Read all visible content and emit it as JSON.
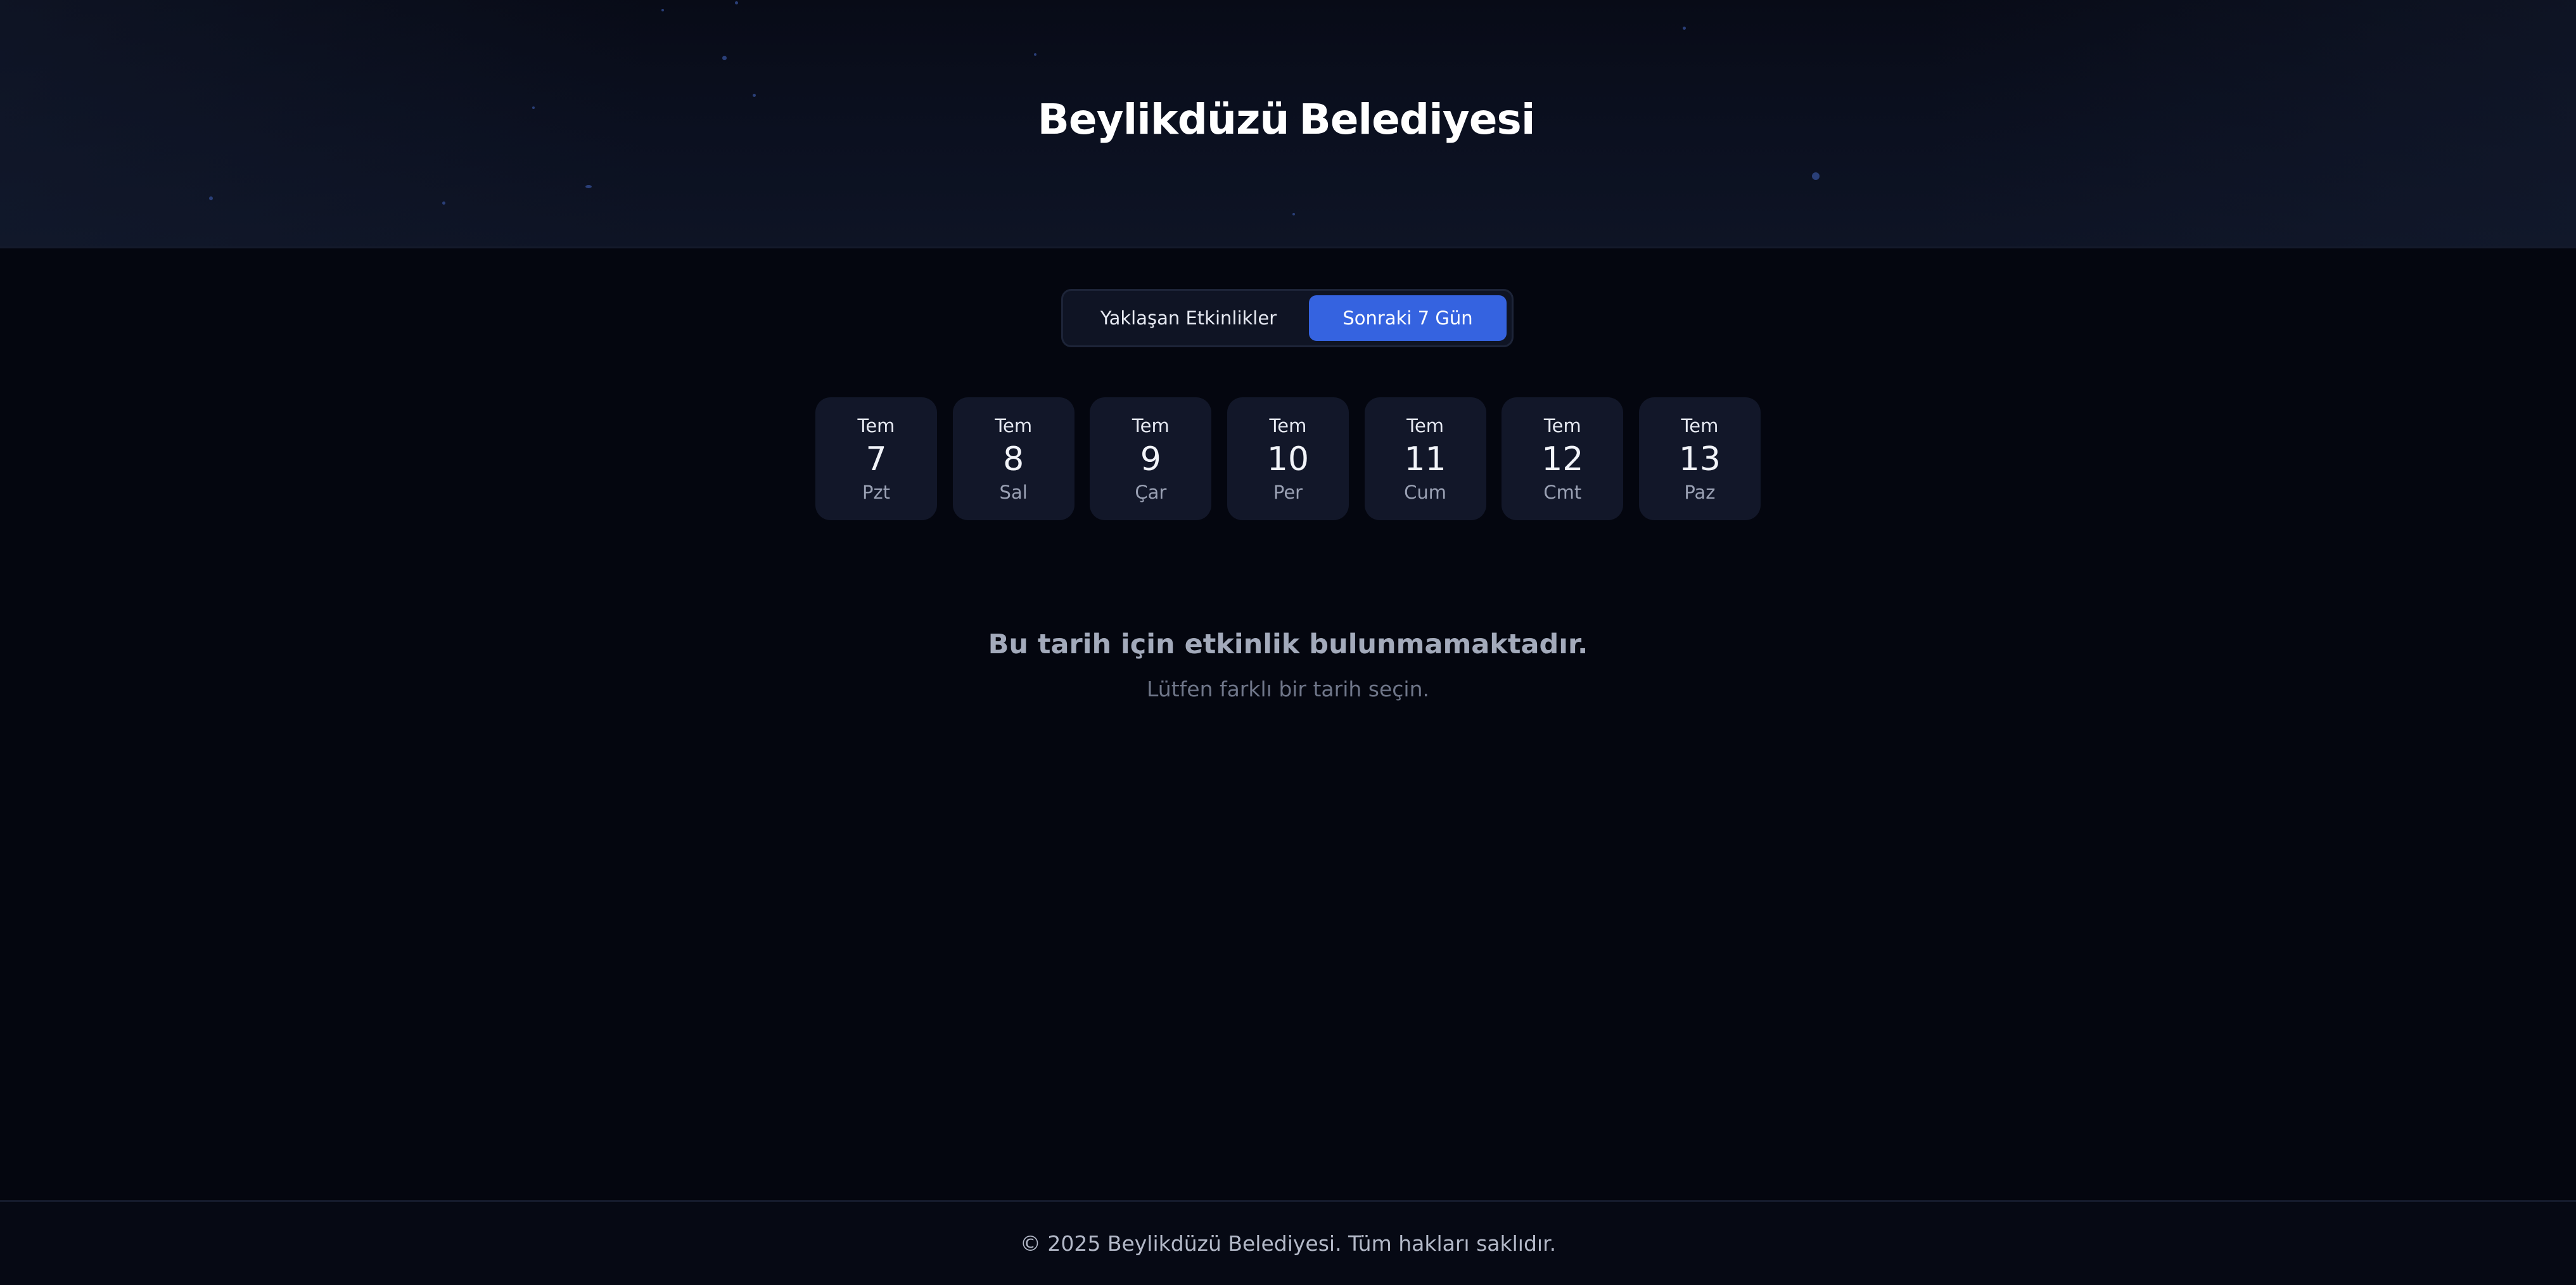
{
  "header": {
    "logo": {
      "word_left": "Beylikdüzü",
      "word_right": "Belediyesi",
      "bird_icon": "swallow-bird-icon"
    }
  },
  "view_toggle": {
    "options": [
      {
        "label": "Yaklaşan Etkinlikler",
        "active": false
      },
      {
        "label": "Sonraki 7 Gün",
        "active": true
      }
    ],
    "active_color": "#3563e0"
  },
  "days": [
    {
      "month": "Tem",
      "day": "7",
      "weekday": "Pzt"
    },
    {
      "month": "Tem",
      "day": "8",
      "weekday": "Sal"
    },
    {
      "month": "Tem",
      "day": "9",
      "weekday": "Çar"
    },
    {
      "month": "Tem",
      "day": "10",
      "weekday": "Per"
    },
    {
      "month": "Tem",
      "day": "11",
      "weekday": "Cum"
    },
    {
      "month": "Tem",
      "day": "12",
      "weekday": "Cmt"
    },
    {
      "month": "Tem",
      "day": "13",
      "weekday": "Paz"
    }
  ],
  "empty_state": {
    "title": "Bu tarih için etkinlik bulunmamaktadır.",
    "subtitle": "Lütfen farklı bir tarih seçin."
  },
  "footer": {
    "copyright": "© 2025 Beylikdüzü Belediyesi. Tüm hakları saklıdır."
  },
  "colors": {
    "background": "#04060f",
    "card": "#121729",
    "accent": "#3563e0"
  }
}
